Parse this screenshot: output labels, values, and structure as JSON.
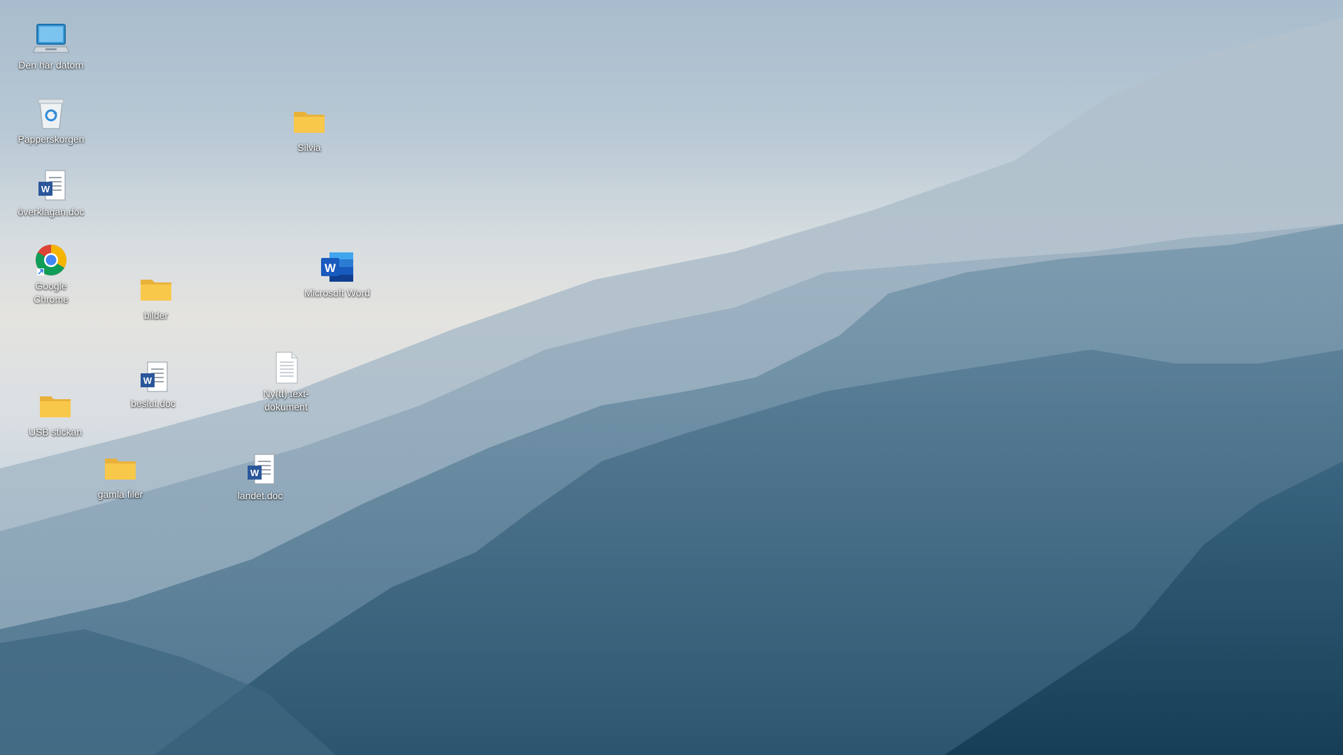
{
  "desktop": {
    "icons": [
      {
        "id": "this-pc",
        "label": "Den här datorn",
        "icon": "computer-icon"
      },
      {
        "id": "recycle-bin",
        "label": "Papperskorgen",
        "icon": "recycle-bin-icon"
      },
      {
        "id": "overklagan",
        "label": "överklagan.doc",
        "icon": "word-document-icon"
      },
      {
        "id": "chrome",
        "label": "Google Chrome",
        "icon": "chrome-icon"
      },
      {
        "id": "silvia",
        "label": "Silvia",
        "icon": "folder-icon"
      },
      {
        "id": "bilder",
        "label": "bilder",
        "icon": "folder-icon"
      },
      {
        "id": "word",
        "label": "Microsoft Word",
        "icon": "word-app-icon"
      },
      {
        "id": "beslut",
        "label": "beslut.doc",
        "icon": "word-document-icon"
      },
      {
        "id": "nytt-text",
        "label": "Ny(tt) text-dokument",
        "icon": "text-document-icon"
      },
      {
        "id": "usb",
        "label": "USB stickan",
        "icon": "folder-icon"
      },
      {
        "id": "gamla",
        "label": "gamla filer",
        "icon": "folder-icon"
      },
      {
        "id": "landet",
        "label": "landet.doc",
        "icon": "word-document-icon"
      }
    ]
  },
  "colors": {
    "folder": "#f8c84a",
    "word_blue": "#2b579a",
    "sky_top": "#a8bccd",
    "mountain_dark": "#1f4a63"
  }
}
